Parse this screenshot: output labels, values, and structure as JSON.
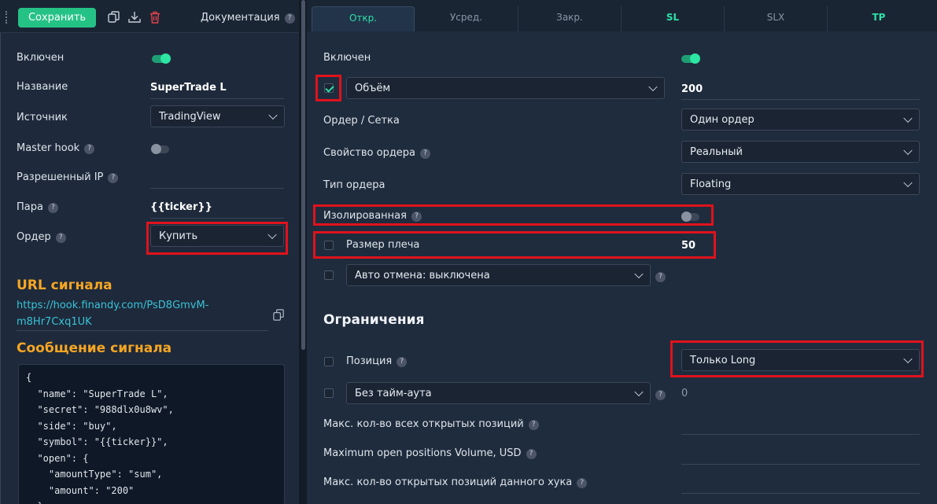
{
  "toolbar": {
    "save_label": "Сохранить",
    "docs_label": "Документация",
    "help": "?"
  },
  "left": {
    "enabled_label": "Включен",
    "name_label": "Название",
    "name_value": "SuperTrade L",
    "source_label": "Источник",
    "source_value": "TradingView",
    "master_hook_label": "Master hook",
    "allowed_ip_label": "Разрешенный IP",
    "pair_label": "Пара",
    "pair_value": "{{ticker}}",
    "order_label": "Ордер",
    "order_value": "Купить",
    "signal_url_title": "URL сигнала",
    "signal_url": "https://hook.finandy.com/PsD8GmvM-m8Hr7Cxq1UK",
    "signal_message_title": "Сообщение сигнала",
    "signal_message": "{\n  \"name\": \"SuperTrade L\",\n  \"secret\": \"988dlx0u8wv\",\n  \"side\": \"buy\",\n  \"symbol\": \"{{ticker}}\",\n  \"open\": {\n    \"amountType\": \"sum\",\n    \"amount\": \"200\"\n  },"
  },
  "tabs": [
    "Откр.",
    "Усред.",
    "Закр.",
    "SL",
    "SLX",
    "TP"
  ],
  "right": {
    "enabled_label": "Включен",
    "volume_select": "Объём",
    "volume_value": "200",
    "order_grid_label": "Ордер / Сетка",
    "order_grid_value": "Один ордер",
    "order_property_label": "Свойство ордера",
    "order_property_value": "Реальный",
    "order_type_label": "Тип ордера",
    "order_type_value": "Floating",
    "isolated_label": "Изолированная",
    "leverage_label": "Размер плеча",
    "leverage_value": "50",
    "auto_cancel_value": "Авто отмена: выключена",
    "limits_title": "Ограничения",
    "position_label": "Позиция",
    "position_value": "Только Long",
    "timeout_value": "Без тайм-аута",
    "timeout_number": "0",
    "max_all_positions_label": "Макс. кол-во всех открытых позиций",
    "max_positions_volume_label": "Maximum open positions Volume, USD",
    "max_hook_positions_label": "Макс. кол-во открытых позиций данного хука"
  },
  "colors": {
    "accent": "#25c286",
    "highlight_box": "#e0121c",
    "section_title": "#f6a623",
    "link": "#39c2d7"
  }
}
